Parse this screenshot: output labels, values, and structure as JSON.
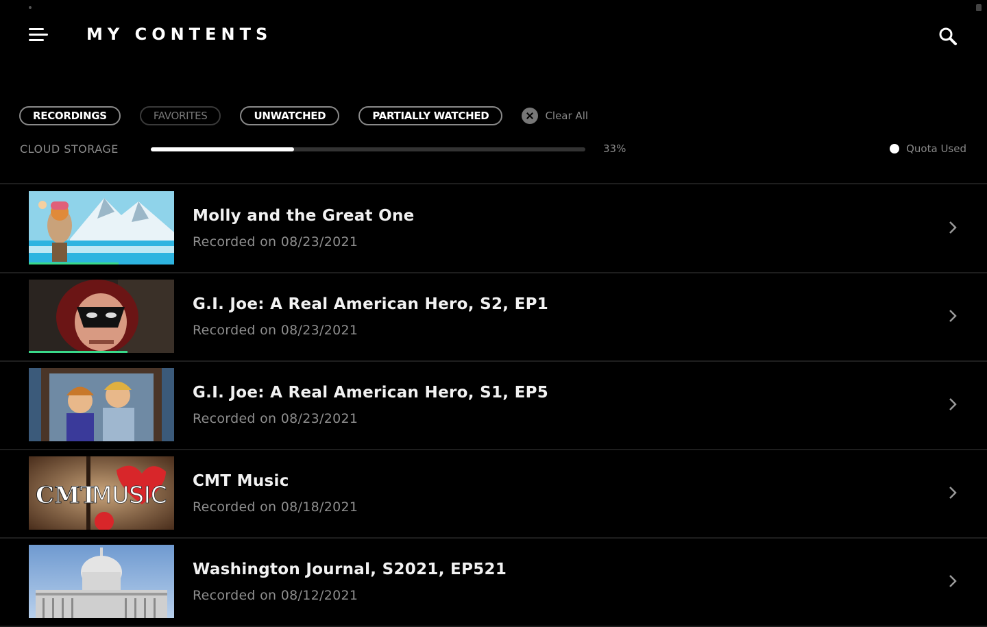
{
  "header": {
    "title": "MY CONTENTS",
    "menu_icon": "hamburger-menu-icon",
    "search_icon": "search-icon"
  },
  "filters": [
    {
      "label": "RECORDINGS",
      "active": true
    },
    {
      "label": "FAVORITES",
      "active": false
    },
    {
      "label": "UNWATCHED",
      "active": true
    },
    {
      "label": "PARTIALLY WATCHED",
      "active": true
    }
  ],
  "clear_all": {
    "label": "Clear All",
    "icon": "close-circle-icon"
  },
  "storage": {
    "label": "CLOUD STORAGE",
    "percent_text": "33%",
    "percent_value": 33,
    "legend_label": "Quota Used"
  },
  "recordings": [
    {
      "title": "Molly and the Great One",
      "subtitle": "Recorded on 08/23/2021",
      "watched_fraction": 0.62,
      "thumb": "molly"
    },
    {
      "title": "G.I. Joe: A Real American Hero, S2, EP1",
      "subtitle": "Recorded on 08/23/2021",
      "watched_fraction": 0.68,
      "thumb": "gijoe1"
    },
    {
      "title": "G.I. Joe: A Real American Hero, S1, EP5",
      "subtitle": "Recorded on 08/23/2021",
      "watched_fraction": 0,
      "thumb": "gijoe2"
    },
    {
      "title": "CMT Music",
      "subtitle": "Recorded on 08/18/2021",
      "watched_fraction": 0,
      "thumb": "cmt",
      "thumb_text_bold": "CMT",
      "thumb_text_light": "MUSIC"
    },
    {
      "title": "Washington Journal, S2021, EP521",
      "subtitle": "Recorded on 08/12/2021",
      "watched_fraction": 0,
      "thumb": "capitol"
    }
  ],
  "colors": {
    "background": "#000000",
    "progress": "#39d98a",
    "muted": "#8a8a8a"
  }
}
